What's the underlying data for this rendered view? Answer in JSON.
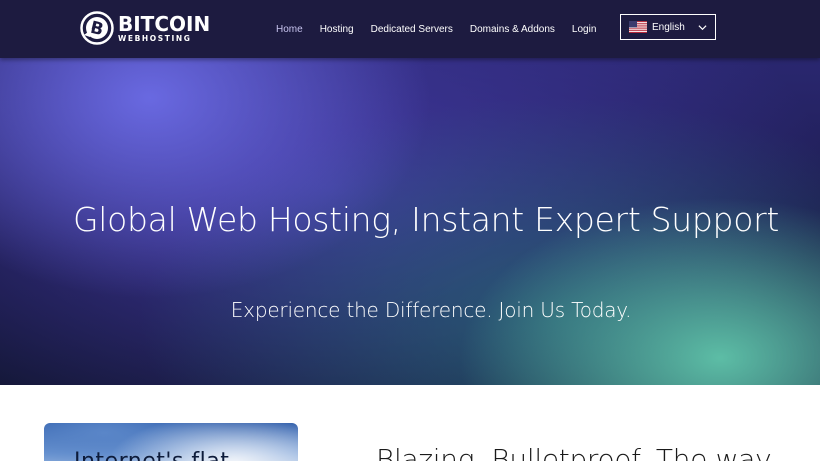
{
  "header": {
    "logo": {
      "line1": "BITCOIN",
      "line2": "WEBHOSTING"
    },
    "nav": [
      {
        "label": "Home",
        "active": true
      },
      {
        "label": "Hosting",
        "active": false
      },
      {
        "label": "Dedicated Servers",
        "active": false
      },
      {
        "label": "Domains & Addons",
        "active": false
      },
      {
        "label": "Login",
        "active": false
      }
    ],
    "language": {
      "selected": "English",
      "flag_icon": "us-flag-icon"
    }
  },
  "hero": {
    "title": "Global Web Hosting, Instant Expert Support",
    "subtitle": "Experience the Difference. Join Us Today."
  },
  "section": {
    "image_text": "Internet's flat",
    "title": "Blazing. Bulletproof. The way"
  },
  "colors": {
    "header_bg": "#1d1b40",
    "hero_purple": "#6c6ce6",
    "hero_teal": "#60c4aa",
    "text_light": "#ffffff"
  }
}
